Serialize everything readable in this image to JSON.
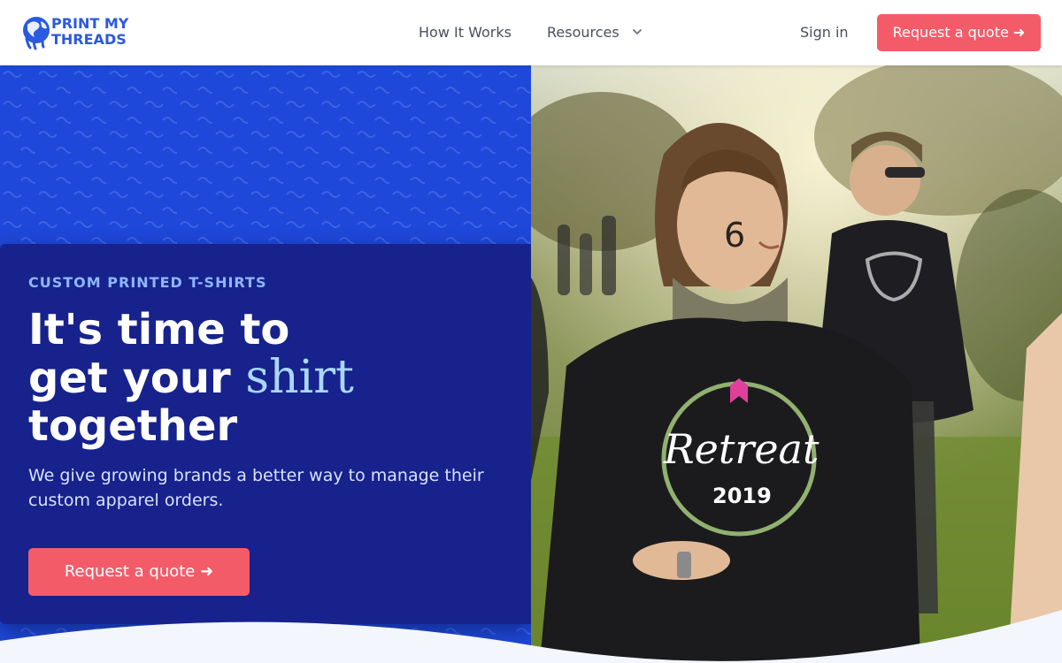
{
  "header": {
    "logo_text": "PRINT MY THREADS",
    "nav": {
      "how_it_works": "How It Works",
      "resources": "Resources",
      "sign_in": "Sign in"
    },
    "cta": "Request a quote ➜"
  },
  "hero": {
    "eyebrow": "CUSTOM PRINTED T-SHIRTS",
    "headline_line1": "It's time to",
    "headline_line2_a": "get your ",
    "headline_accent": "shirt",
    "headline_line3": "together",
    "subcopy": "We give growing brands a better way to manage their custom apparel orders.",
    "cta": "Request a quote ➜",
    "photo_alt": "Runners at a trail event wearing black Retreat 2019 shirts",
    "shirt_print_text": "Retreat",
    "shirt_print_year": "2019",
    "face_paint": "6"
  },
  "colors": {
    "brand_blue": "#1e48d9",
    "card_navy": "#17228c",
    "accent_coral": "#f45b69",
    "eyebrow_blue": "#8fb6ff",
    "accent_word": "#a9d7ff"
  },
  "icons": {
    "logo_globe": "globe-icon",
    "resources_chevron": "chevron-down-icon",
    "arrow": "arrow-right-icon"
  }
}
